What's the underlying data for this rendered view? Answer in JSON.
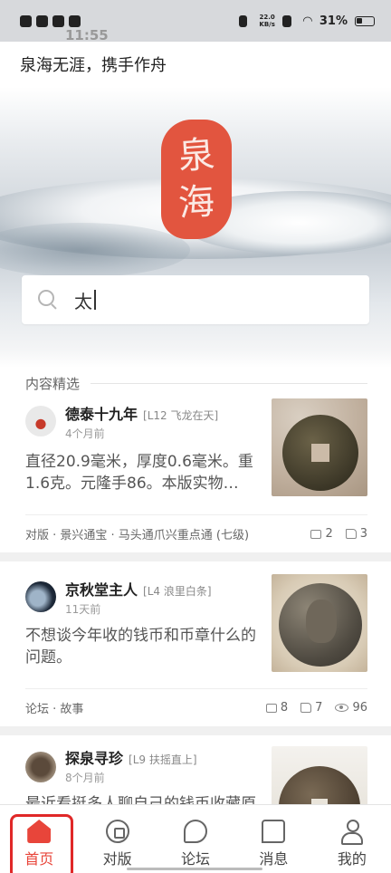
{
  "status_bar": {
    "time": "11:55",
    "net_speed_value": "22.0",
    "net_speed_unit": "KB/s",
    "battery": "31%"
  },
  "header": {
    "slogan": "泉海无涯，携手作舟",
    "seal_chars": [
      "泉",
      "海"
    ]
  },
  "search": {
    "value": "太",
    "icon": "search-icon"
  },
  "section": {
    "title": "内容精选"
  },
  "posts": [
    {
      "author": "德泰十九年",
      "level": "[L12 飞龙在天]",
      "time": "4个月前",
      "excerpt": "直径20.9毫米，厚度0.6毫米。重1.6克。元隆手86。本版实物…",
      "tags": "对版 · 景兴通宝 · 马头通爪兴重点通 (七级)",
      "comments": "2",
      "likes": "3"
    },
    {
      "author": "京秋堂主人",
      "level": "[L4 浪里白条]",
      "time": "11天前",
      "excerpt": "不想谈今年收的钱币和币章什么的问题。",
      "tags": "论坛 · 故事",
      "comments": "8",
      "likes": "7",
      "views": "96"
    },
    {
      "author": "探泉寻珍",
      "level": "[L9 扶摇直上]",
      "time": "8个月前",
      "excerpt": "最近看挺多人聊自己的钱币收藏原因的，我想了想也想和大家"
    }
  ],
  "bottom_nav": [
    {
      "label": "首页",
      "icon": "home-icon",
      "active": true
    },
    {
      "label": "对版",
      "icon": "compare-icon",
      "active": false
    },
    {
      "label": "论坛",
      "icon": "forum-icon",
      "active": false
    },
    {
      "label": "消息",
      "icon": "message-icon",
      "active": false
    },
    {
      "label": "我的",
      "icon": "profile-icon",
      "active": false
    }
  ],
  "colors": {
    "accent": "#e8453a",
    "seal": "#e2553f",
    "highlight_border": "#e02828"
  }
}
